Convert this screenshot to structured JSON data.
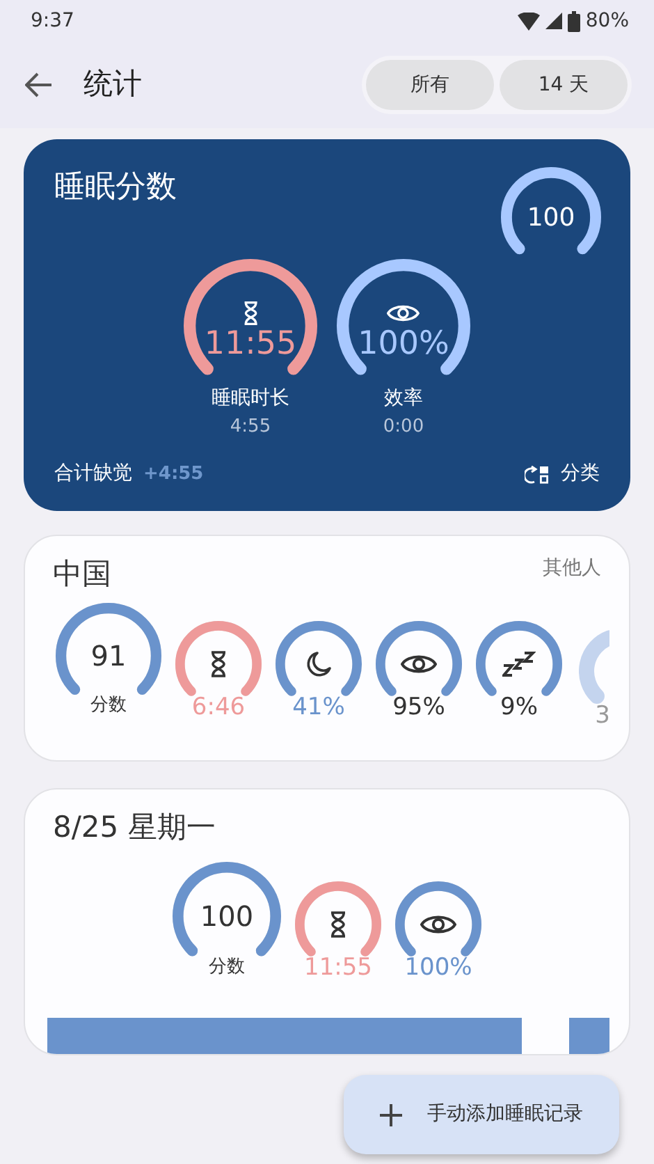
{
  "status_bar": {
    "time": "9:37",
    "battery": "80%"
  },
  "header": {
    "title": "统计",
    "range_options": [
      {
        "label": "所有",
        "selected": false
      },
      {
        "label": "14 天",
        "selected": false
      }
    ]
  },
  "summary_card": {
    "title": "睡眠分数",
    "score": {
      "value": "100"
    },
    "metrics": [
      {
        "kind": "duration",
        "value": "11:55",
        "label": "睡眠时长",
        "sub": "4:55"
      },
      {
        "kind": "efficiency",
        "value": "100%",
        "label": "效率",
        "sub": "0:00"
      }
    ],
    "deficit_label": "合计缺觉",
    "deficit_value": "+4:55",
    "action": "分类"
  },
  "group_card": {
    "title": "中国",
    "action": "其他人",
    "gauges": [
      {
        "kind": "score",
        "value": "91",
        "caption": "分数",
        "color": "#333333"
      },
      {
        "kind": "duration",
        "value": "6:46",
        "color": "#ee9a9a"
      },
      {
        "kind": "deep",
        "value": "41%",
        "color": "#6a93cc"
      },
      {
        "kind": "efficiency",
        "value": "95%",
        "color": "#333333"
      },
      {
        "kind": "snore",
        "value": "9%",
        "color": "#333333"
      },
      {
        "kind": "partial",
        "value": "3",
        "color": "#999999"
      }
    ]
  },
  "day_card": {
    "title": "8/25 星期一",
    "gauges": [
      {
        "kind": "score",
        "value": "100",
        "caption": "分数",
        "color": "#333333"
      },
      {
        "kind": "duration",
        "value": "11:55",
        "color": "#ee9a9a"
      },
      {
        "kind": "efficiency",
        "value": "100%",
        "color": "#6a93cc"
      }
    ]
  },
  "fab": {
    "label": "手动添加睡眠记录"
  }
}
